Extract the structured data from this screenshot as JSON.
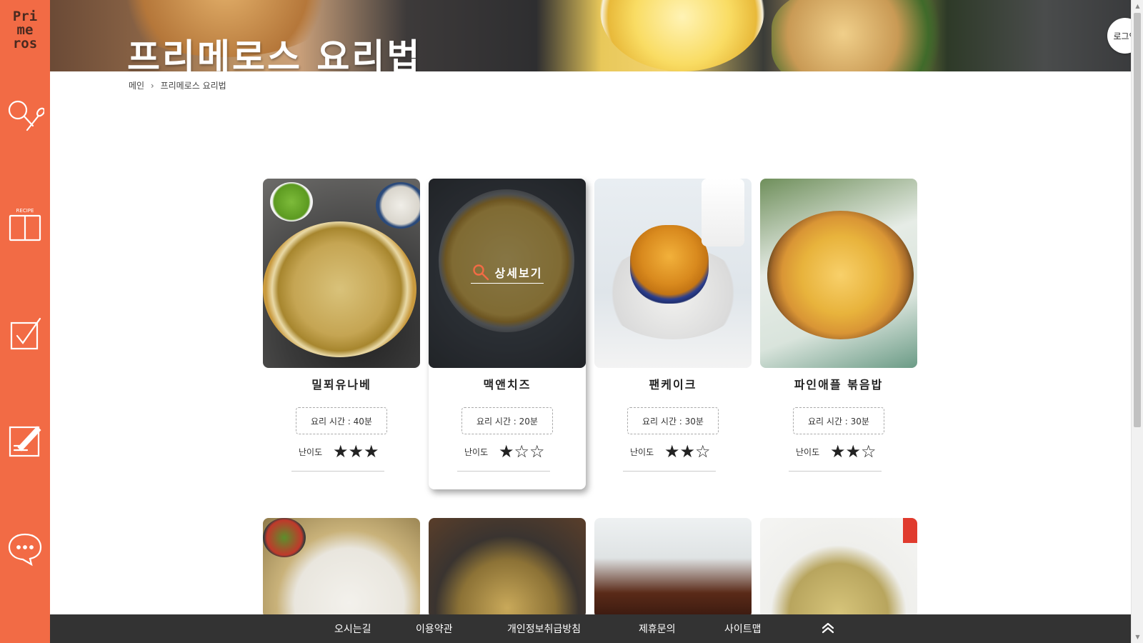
{
  "brand": {
    "logo_lines": [
      "Pri",
      "me",
      "ros"
    ]
  },
  "sidebar": {
    "items": [
      {
        "name": "search-recipe",
        "icon": "magnifier-spoon-icon"
      },
      {
        "name": "recipe-book",
        "icon": "recipe-book-icon",
        "icon_label": "RECIPE"
      },
      {
        "name": "checklist",
        "icon": "checkbox-icon"
      },
      {
        "name": "write",
        "icon": "notepad-pencil-icon"
      },
      {
        "name": "chat",
        "icon": "speech-bubble-icon"
      }
    ]
  },
  "header": {
    "title": "프리메로스 요리법",
    "login_label": "로그인"
  },
  "breadcrumb": {
    "home": "메인",
    "current": "프리메로스 요리법"
  },
  "detail_label": "상세보기",
  "difficulty_label": "난이도",
  "recipes": [
    {
      "title": "밀푀유나베",
      "time": "요리 시간 : 40분",
      "difficulty": 3,
      "stars": "★★★"
    },
    {
      "title": "맥앤치즈",
      "time": "요리 시간 : 20분",
      "difficulty": 1,
      "stars": "★☆☆"
    },
    {
      "title": "팬케이크",
      "time": "요리 시간 : 30분",
      "difficulty": 2,
      "stars": "★★☆"
    },
    {
      "title": "파인애플 볶음밥",
      "time": "요리 시간 : 30분",
      "difficulty": 2,
      "stars": "★★☆"
    }
  ],
  "footer": {
    "links": [
      "오시는길",
      "이용약관",
      "개인정보취급방침",
      "제휴문의",
      "사이트맵"
    ],
    "top_icon": "double-chevron-up-icon"
  },
  "colors": {
    "accent": "#f26b45",
    "footer_bg": "#333333",
    "logo_text": "#4a2a20"
  }
}
